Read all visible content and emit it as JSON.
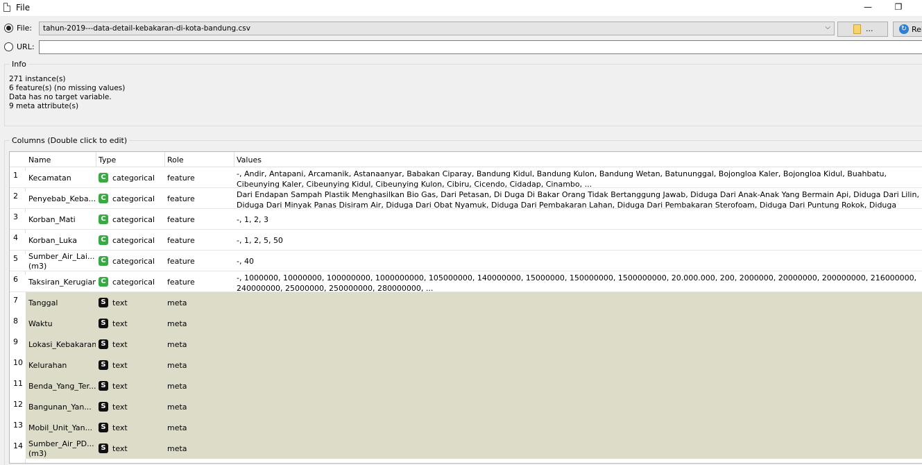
{
  "window": {
    "title": "File",
    "minimize_glyph": "—",
    "restore_glyph": "❐"
  },
  "source": {
    "file_label": "File:",
    "file_value": "tahun-2019---data-detail-kebakaran-di-kota-bandung.csv",
    "browse_label": "...",
    "reload_label": "Reload",
    "url_label": "URL:",
    "url_value": ""
  },
  "info": {
    "title": "Info",
    "lines": [
      "271 instance(s)",
      "6 feature(s) (no missing values)",
      "Data has no target variable.",
      "9 meta attribute(s)"
    ]
  },
  "columns": {
    "title": "Columns (Double click to edit)",
    "headers": [
      "Name",
      "Type",
      "Role",
      "Values"
    ],
    "rows": [
      {
        "num": "1",
        "name": "Kecamatan",
        "type_icon": "C",
        "type": "categorical",
        "role": "feature",
        "values": "-, Andir, Antapani, Arcamanik, Astanaanyar, Babakan Ciparay, Bandung Kidul, Bandung Kulon, Bandung Wetan, Batununggal, Bojongloa Kaler, Bojongloa Kidul, Buahbatu, Cibeunying Kaler, Cibeunying Kidul, Cibeunying Kulon, Cibiru, Cicendo, Cidadap, Cinambo, ..."
      },
      {
        "num": "2",
        "name": "Penyebab_Keba...",
        "type_icon": "C",
        "type": "categorical",
        "role": "feature",
        "values": "Dari Endapan Sampah Plastik Menghasilkan Bio Gas, Dari Petasan, Di Duga Di Bakar Orang Tidak Bertanggung Jawab, Diduga Dari Anak-Anak Yang Bermain Api, Diduga Dari Lilin, Diduga Dari Minyak Panas Disiram Air, Diduga Dari Obat Nyamuk, Diduga Dari Pembakaran Lahan, Diduga Dari Pembakaran Sterofoam, Diduga Dari Puntung Rokok, Diduga Kebocoran Selang G..."
      },
      {
        "num": "3",
        "name": "Korban_Mati",
        "type_icon": "C",
        "type": "categorical",
        "role": "feature",
        "values": "-, 1, 2, 3"
      },
      {
        "num": "4",
        "name": "Korban_Luka",
        "type_icon": "C",
        "type": "categorical",
        "role": "feature",
        "values": "-, 1, 2, 5, 50"
      },
      {
        "num": "5",
        "name": "Sumber_Air_Lai... (m3)",
        "type_icon": "C",
        "type": "categorical",
        "role": "feature",
        "values": "-, 40"
      },
      {
        "num": "6",
        "name": "Taksiran_Kerugian",
        "type_icon": "C",
        "type": "categorical",
        "role": "feature",
        "values": "-, 1000000, 10000000, 100000000, 1000000000, 105000000, 140000000, 15000000, 150000000, 1500000000, 20.000.000, 200, 2000000, 20000000, 200000000, 216000000, 240000000, 25000000, 250000000, 280000000, ..."
      },
      {
        "num": "7",
        "name": "Tanggal",
        "type_icon": "S",
        "type": "text",
        "role": "meta",
        "values": ""
      },
      {
        "num": "8",
        "name": "Waktu",
        "type_icon": "S",
        "type": "text",
        "role": "meta",
        "values": ""
      },
      {
        "num": "9",
        "name": "Lokasi_Kebakaran",
        "type_icon": "S",
        "type": "text",
        "role": "meta",
        "values": ""
      },
      {
        "num": "10",
        "name": "Kelurahan",
        "type_icon": "S",
        "type": "text",
        "role": "meta",
        "values": ""
      },
      {
        "num": "11",
        "name": "Benda_Yang_Ter...",
        "type_icon": "S",
        "type": "text",
        "role": "meta",
        "values": ""
      },
      {
        "num": "12",
        "name": "Bangunan_Yan...",
        "type_icon": "S",
        "type": "text",
        "role": "meta",
        "values": ""
      },
      {
        "num": "13",
        "name": "Mobil_Unit_Yan...",
        "type_icon": "S",
        "type": "text",
        "role": "meta",
        "values": ""
      },
      {
        "num": "14",
        "name": "Sumber_Air_PD... (m3)",
        "type_icon": "S",
        "type": "text",
        "role": "meta",
        "values": ""
      }
    ]
  },
  "colors": {
    "meta_row_bg": "#dcdcc9",
    "categorical_icon": "#3aa843",
    "text_icon": "#111111"
  }
}
